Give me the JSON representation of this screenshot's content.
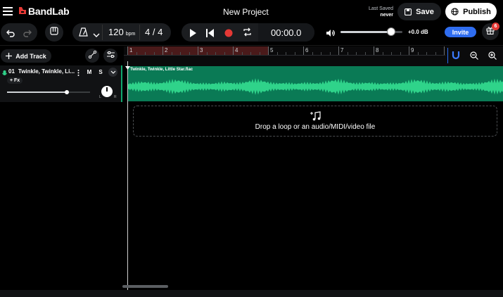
{
  "app": {
    "name": "BandLab",
    "project_title": "New Project"
  },
  "header": {
    "last_saved_label": "Last Saved",
    "last_saved_value": "never",
    "save_label": "Save",
    "publish_label": "Publish"
  },
  "toolbar": {
    "bpm_value": "120",
    "bpm_unit": "bpm",
    "time_signature": "4 / 4",
    "time_display": "00:00.0",
    "volume_level": 0.82,
    "volume_label": "+0.0 dB",
    "invite_label": "Invite",
    "gift_badge_count": "6"
  },
  "track_panel": {
    "add_track_label": "Add Track",
    "track": {
      "number": "01",
      "name": "Twinkle, Twinkle, Li...",
      "mute_label": "M",
      "solo_label": "S",
      "fx_label": "+ Fx",
      "volume_level": 0.72,
      "pan_left_label": "L",
      "pan_right_label": "R"
    }
  },
  "timeline": {
    "ruler_numbers": [
      "1",
      "2",
      "3",
      "4",
      "5",
      "6",
      "7",
      "8",
      "9"
    ],
    "clip_name": "Twinkle, Twinkle, Little Star.flac",
    "drop_zone_text": "Drop a loop or an audio/MIDI/video file"
  },
  "colors": {
    "brand_red": "#e53935",
    "clip_green": "#0a7a55",
    "wave_green": "#2fd38a",
    "invite_blue": "#2f6df0",
    "loop_region": "#4a1a1a",
    "accent_blue": "#3d7bff"
  },
  "icons": [
    "menu-icon",
    "bandlab-logo-icon",
    "save-icon",
    "globe-icon",
    "undo-icon",
    "redo-icon",
    "piano-icon",
    "metronome-icon",
    "chevron-down-icon",
    "play-icon",
    "skip-back-icon",
    "record-icon",
    "loop-icon",
    "speaker-icon",
    "gift-icon",
    "plus-icon",
    "automation-icon",
    "settings-icon",
    "microphone-icon",
    "magnet-icon",
    "zoom-out-icon",
    "zoom-in-icon",
    "audio-midi-add-icon"
  ]
}
